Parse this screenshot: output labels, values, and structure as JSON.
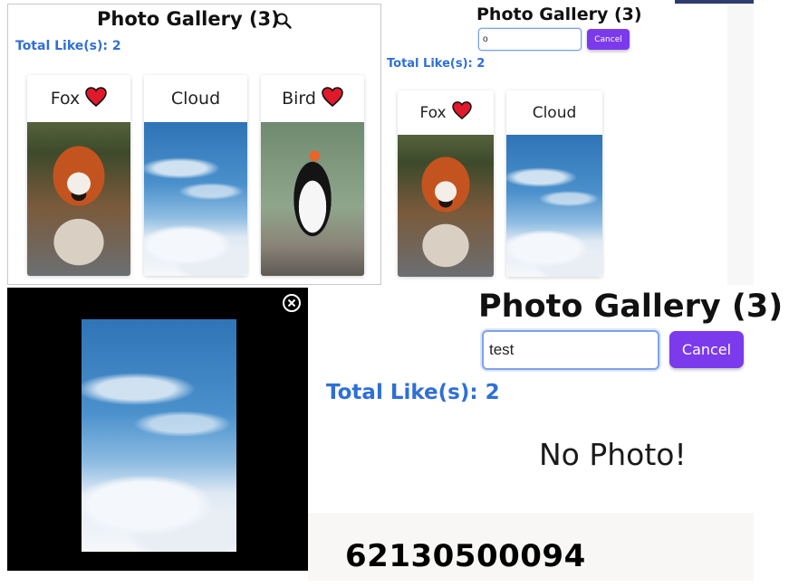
{
  "gallery": {
    "title": "Photo Gallery (3)",
    "total_likes": "Total Like(s): 2",
    "photos": [
      {
        "label": "Fox",
        "liked": true
      },
      {
        "label": "Cloud",
        "liked": false
      },
      {
        "label": "Bird",
        "liked": true
      }
    ]
  },
  "filtered": {
    "title": "Photo Gallery (3)",
    "search_value": "o",
    "cancel_label": "Cancel",
    "total_likes": "Total Like(s): 2",
    "photos": [
      {
        "label": "Fox",
        "liked": true
      },
      {
        "label": "Cloud",
        "liked": false
      }
    ]
  },
  "viewer": {
    "photo": "Cloud"
  },
  "empty": {
    "title": "Photo Gallery (3)",
    "search_value": "test",
    "cancel_label": "Cancel",
    "total_likes": "Total Like(s): 2",
    "message": "No Photo!"
  },
  "student_id": "62130500094",
  "colors": {
    "accent_purple": "#7c3aed",
    "likes_blue": "#2f6fd6",
    "heart_red": "#e0192b"
  }
}
